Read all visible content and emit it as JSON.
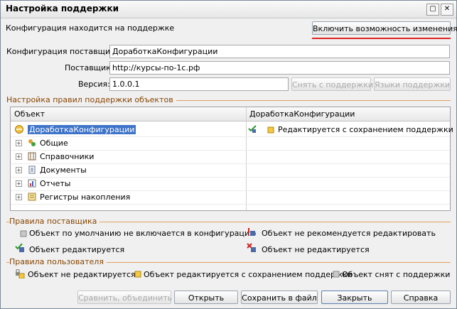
{
  "window": {
    "title": "Настройка поддержки",
    "restore_glyph": "▢",
    "close_glyph": "✕"
  },
  "top": {
    "status": "Конфигурация находится на поддержке",
    "enable_button": "Включить возможность изменения"
  },
  "fields": {
    "vendor_config_label": "Конфигурация поставщика:",
    "vendor_config_value": "ДоработкаКонфигурации",
    "vendor_label": "Поставщик:",
    "vendor_value": "http://курсы-по-1с.рф",
    "version_label": "Версия:",
    "version_value": "1.0.0.1",
    "remove_support_button": "Снять с поддержки",
    "languages_button": "Языки поддержки"
  },
  "rules_group": {
    "title": "Настройка правил поддержки объектов",
    "columns": [
      "Объект",
      "ДоработкаКонфигурации"
    ],
    "rows": [
      {
        "name": "ДоработкаКонфигурации",
        "icon": "config-root-icon",
        "rule": "Редактируется с сохранением поддержки",
        "selected": true
      },
      {
        "name": "Общие",
        "icon": "common-icon",
        "rule": ""
      },
      {
        "name": "Справочники",
        "icon": "catalog-icon",
        "rule": ""
      },
      {
        "name": "Документы",
        "icon": "document-icon",
        "rule": ""
      },
      {
        "name": "Отчеты",
        "icon": "report-icon",
        "rule": ""
      },
      {
        "name": "Регистры накопления",
        "icon": "register-icon",
        "rule": ""
      }
    ]
  },
  "vendor_rules": {
    "title": "Правила поставщика",
    "items": [
      "Объект по умолчанию не включается в конфигурацию",
      "Объект не рекомендуется редактировать",
      "Объект редактируется",
      "Объект не редактируется"
    ]
  },
  "user_rules": {
    "title": "Правила пользователя",
    "items": [
      "Объект не редактируется",
      "Объект редактируется с сохранением поддержки",
      "Объект снят с поддержки"
    ]
  },
  "bottom_buttons": {
    "compare": "Сравнить, объединить",
    "open": "Открыть",
    "save": "Сохранить в файл",
    "close": "Закрыть",
    "help": "Справка"
  },
  "colors": {
    "accent_underline": "#e02020",
    "group_line": "#e0a060",
    "selection": "#3d73c8"
  }
}
